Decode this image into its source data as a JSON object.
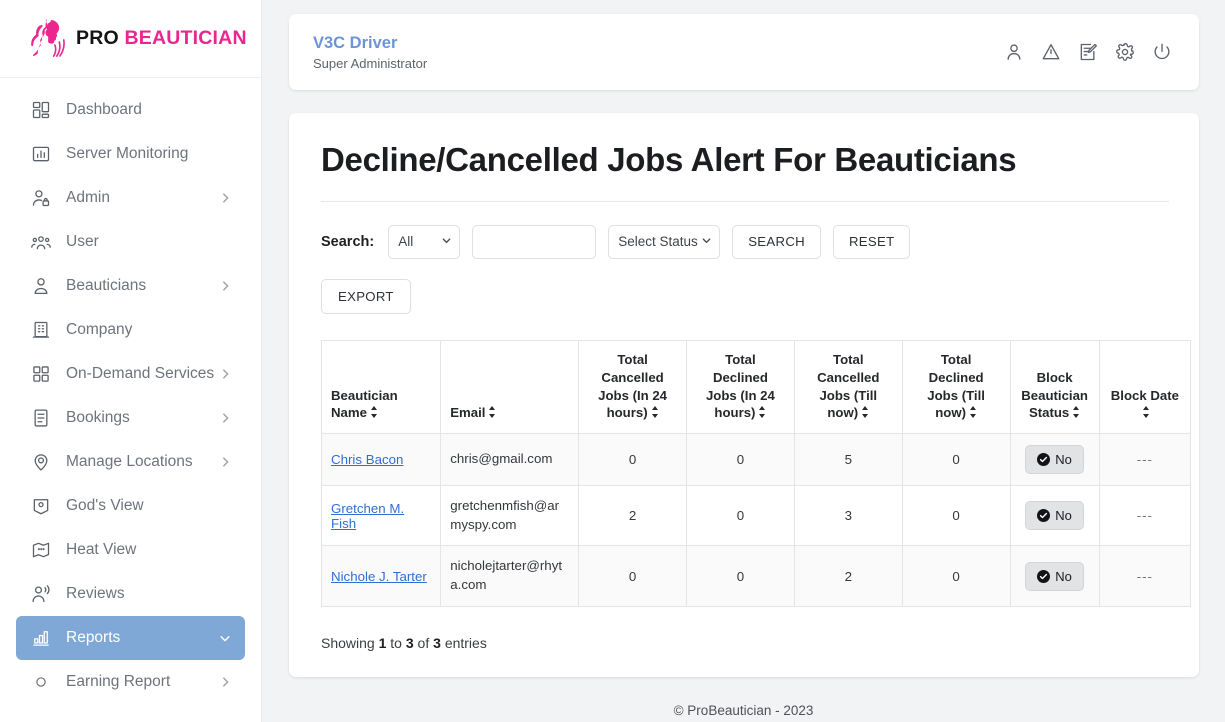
{
  "brand": {
    "logo_icon": "beautician-woman-logo-icon",
    "name_primary": "PRO",
    "name_secondary": "BEAUTICIAN",
    "accent_color": "#ec268f"
  },
  "sidebar": {
    "active_color": "#7fa8d6",
    "items": [
      {
        "label": "Dashboard",
        "icon": "grid-dashboard-icon",
        "has_caret": false,
        "active": false,
        "sub": false
      },
      {
        "label": "Server Monitoring",
        "icon": "bar-chart-icon",
        "has_caret": false,
        "active": false,
        "sub": false
      },
      {
        "label": "Admin",
        "icon": "user-lock-icon",
        "has_caret": true,
        "active": false,
        "sub": false
      },
      {
        "label": "User",
        "icon": "users-group-icon",
        "has_caret": false,
        "active": false,
        "sub": false
      },
      {
        "label": "Beauticians",
        "icon": "user-tie-icon",
        "has_caret": true,
        "active": false,
        "sub": false
      },
      {
        "label": "Company",
        "icon": "building-icon",
        "has_caret": false,
        "active": false,
        "sub": false
      },
      {
        "label": "On-Demand Services",
        "icon": "grid-squares-icon",
        "has_caret": true,
        "active": false,
        "sub": false
      },
      {
        "label": "Bookings",
        "icon": "list-document-icon",
        "has_caret": true,
        "active": false,
        "sub": false
      },
      {
        "label": "Manage Locations",
        "icon": "map-pin-icon",
        "has_caret": true,
        "active": false,
        "sub": false
      },
      {
        "label": "God's View",
        "icon": "map-location-icon",
        "has_caret": false,
        "active": false,
        "sub": false
      },
      {
        "label": "Heat View",
        "icon": "heat-map-icon",
        "has_caret": false,
        "active": false,
        "sub": false
      },
      {
        "label": "Reviews",
        "icon": "user-voice-icon",
        "has_caret": false,
        "active": false,
        "sub": false
      },
      {
        "label": "Reports",
        "icon": "report-bars-icon",
        "has_caret": true,
        "active": true,
        "sub": false
      },
      {
        "label": "Earning Report",
        "icon": "circle-bullet-icon",
        "has_caret": true,
        "active": false,
        "sub": true
      }
    ]
  },
  "topbar": {
    "title": "V3C Driver",
    "subtitle": "Super Administrator",
    "title_color": "#6d94d4",
    "icons": [
      "user-icon",
      "warning-triangle-icon",
      "edit-document-icon",
      "gear-icon",
      "power-icon"
    ]
  },
  "page": {
    "title": "Decline/Cancelled Jobs Alert For Beauticians"
  },
  "filters": {
    "search_label": "Search:",
    "scope_select": {
      "value": "All",
      "options": [
        "All"
      ]
    },
    "keyword_input": {
      "value": "",
      "placeholder": ""
    },
    "status_select": {
      "value": "Select Status",
      "options": [
        "Select Status"
      ]
    },
    "search_button": "SEARCH",
    "reset_button": "RESET",
    "export_button": "EXPORT"
  },
  "table": {
    "columns": [
      {
        "label": "Beautician Name",
        "sortable": true,
        "align": "left"
      },
      {
        "label": "Email",
        "sortable": true,
        "align": "left"
      },
      {
        "label": "Total Cancelled Jobs (In 24 hours)",
        "sortable": true,
        "align": "center"
      },
      {
        "label": "Total Declined Jobs (In 24 hours)",
        "sortable": true,
        "align": "center"
      },
      {
        "label": "Total Cancelled Jobs (Till now)",
        "sortable": true,
        "align": "center"
      },
      {
        "label": "Total Declined Jobs (Till now)",
        "sortable": true,
        "align": "center"
      },
      {
        "label": "Block Beautician Status",
        "sortable": true,
        "align": "center"
      },
      {
        "label": "Block Date",
        "sortable": true,
        "align": "center"
      }
    ],
    "rows": [
      {
        "name": "Chris Bacon",
        "email": "chris@gmail.com",
        "cancelled_24h": "0",
        "declined_24h": "0",
        "cancelled_total": "5",
        "declined_total": "0",
        "block_status": "No",
        "block_date": "---"
      },
      {
        "name": "Gretchen M. Fish",
        "email": "gretchenmfish@armyspy.com",
        "cancelled_24h": "2",
        "declined_24h": "0",
        "cancelled_total": "3",
        "declined_total": "0",
        "block_status": "No",
        "block_date": "---"
      },
      {
        "name": "Nichole J. Tarter",
        "email": "nicholejtarter@rhyta.com",
        "cancelled_24h": "0",
        "declined_24h": "0",
        "cancelled_total": "2",
        "declined_total": "0",
        "block_status": "No",
        "block_date": "---"
      }
    ],
    "info": {
      "prefix": "Showing",
      "from": "1",
      "mid": "to",
      "to": "3",
      "of": "of",
      "total": "3",
      "suffix": "entries"
    }
  },
  "footer": {
    "text": "© ProBeautician - 2023"
  }
}
